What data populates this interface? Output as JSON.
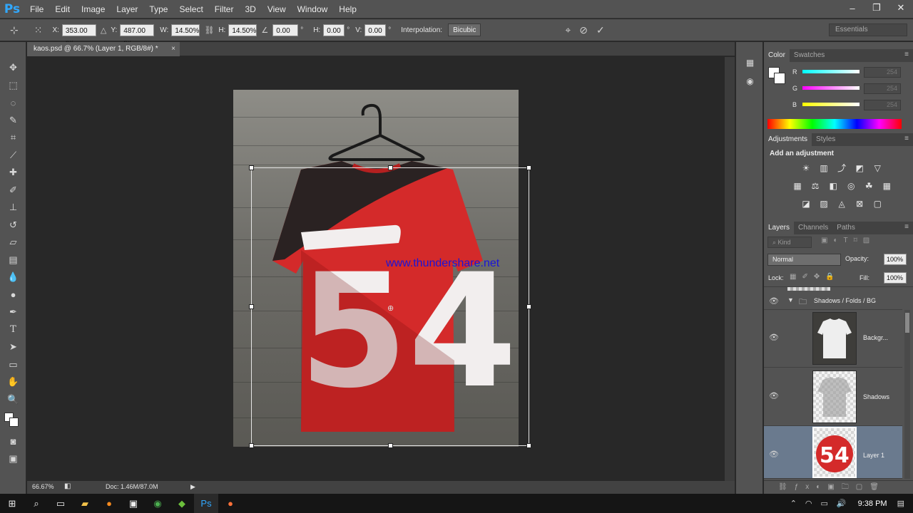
{
  "app": {
    "logo": "Ps",
    "brand_color": "#31a8ff"
  },
  "menu": [
    "File",
    "Edit",
    "Image",
    "Layer",
    "Type",
    "Select",
    "Filter",
    "3D",
    "View",
    "Window",
    "Help"
  ],
  "window_controls": {
    "minimize": "–",
    "restore": "❐",
    "close": "✕"
  },
  "options": {
    "x_label": "X:",
    "x_value": "353.00 px",
    "y_label": "Y:",
    "y_value": "487.00 px",
    "w_label": "W:",
    "w_value": "14.50%",
    "h_label": "H:",
    "h_value": "14.50%",
    "angle_value": "0.00",
    "angle_unit": "°",
    "hskew_label": "H:",
    "hskew_value": "0.00",
    "hskew_unit": "°",
    "vskew_label": "V:",
    "vskew_value": "0.00",
    "vskew_unit": "°",
    "interp_label": "Interpolation:",
    "interp_value": "Bicubic",
    "workspace": "Essentials"
  },
  "document": {
    "tab_title": "kaos.psd @ 66.7% (Layer 1, RGB/8#) *",
    "tab_close": "×",
    "zoom": "66.67%",
    "doc_size": "Doc: 1.46M/87.0M",
    "watermark": "www.thundershare.net",
    "shirt_number": "54",
    "shirt_color": "#d42a2a"
  },
  "color_panel": {
    "tabs": [
      "Color",
      "Swatches"
    ],
    "r_label": "R",
    "r_value": "254",
    "g_label": "G",
    "g_value": "254",
    "b_label": "B",
    "b_value": "254"
  },
  "adjustments_panel": {
    "tabs": [
      "Adjustments",
      "Styles"
    ],
    "heading": "Add an adjustment"
  },
  "layers_panel": {
    "tabs": [
      "Layers",
      "Channels",
      "Paths"
    ],
    "kind_label": "Kind",
    "blend_mode": "Normal",
    "opacity_label": "Opacity:",
    "opacity_value": "100%",
    "lock_label": "Lock:",
    "fill_label": "Fill:",
    "fill_value": "100%",
    "group_name": "Shadows / Folds / BG",
    "layers": [
      {
        "name": "Backgr..."
      },
      {
        "name": "Shadows"
      },
      {
        "name": "Layer 1",
        "selected": true
      }
    ]
  },
  "taskbar": {
    "time": "9:38 PM"
  }
}
